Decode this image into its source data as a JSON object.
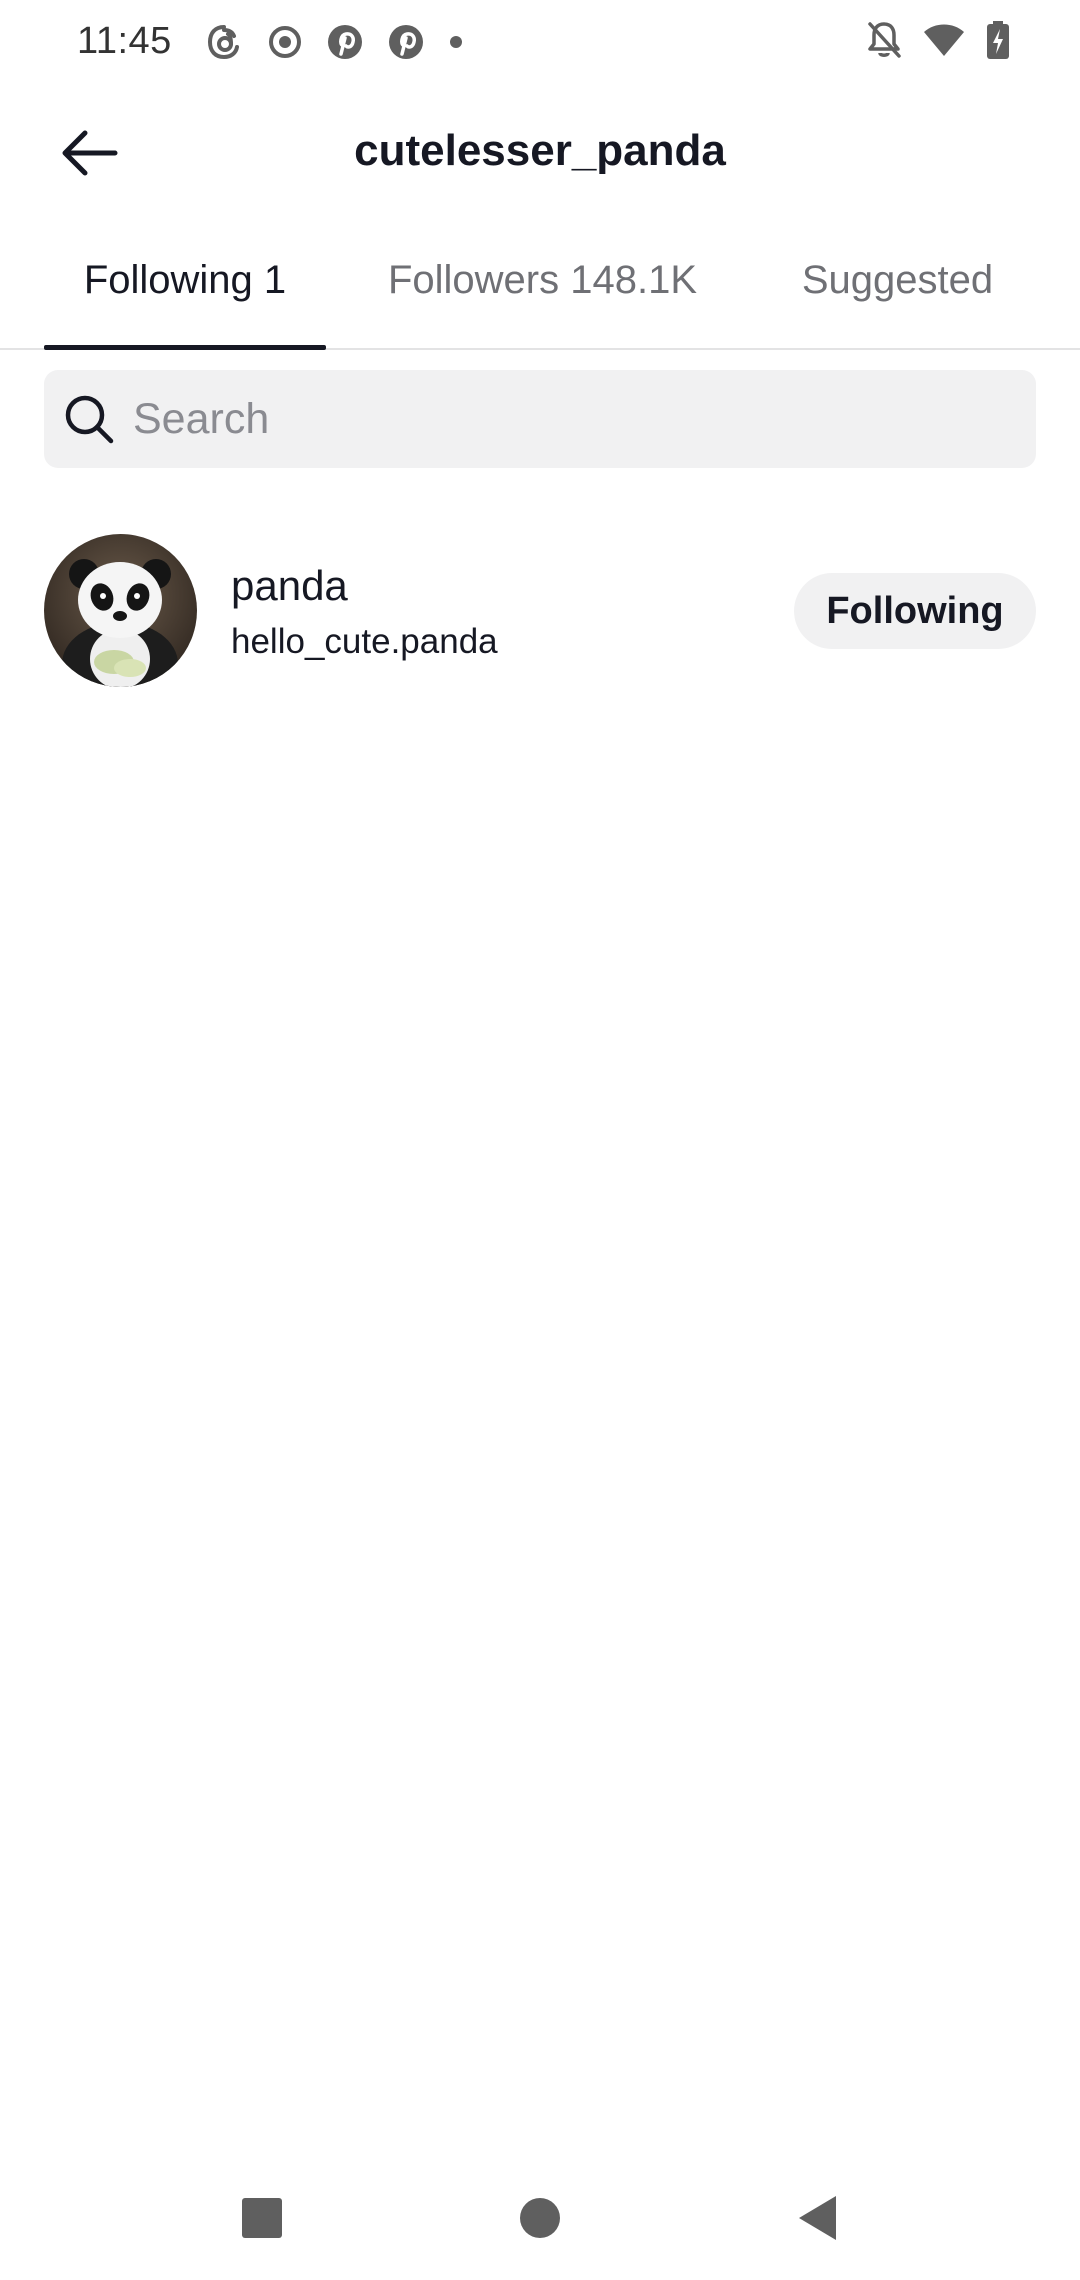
{
  "status_bar": {
    "time": "11:45",
    "left_icons": [
      "threads-icon",
      "record-icon",
      "pinterest-icon",
      "pinterest-icon",
      "dot-icon"
    ],
    "right_icons": [
      "notifications-muted-icon",
      "wifi-icon",
      "battery-charging-icon"
    ]
  },
  "header": {
    "title": "cutelesser_panda",
    "back_icon": "arrow-left-icon"
  },
  "tabs": [
    {
      "label": "Following 1",
      "active": true
    },
    {
      "label": "Followers 148.1K",
      "active": false
    },
    {
      "label": "Suggested",
      "active": false
    }
  ],
  "search": {
    "placeholder": "Search",
    "value": "",
    "icon": "search-icon"
  },
  "users": [
    {
      "name": "panda",
      "handle": "hello_cute.panda",
      "button_label": "Following",
      "avatar": "panda-avatar"
    }
  ],
  "nav_bar": {
    "icons": [
      "recents-square-icon",
      "home-circle-icon",
      "back-triangle-icon"
    ]
  },
  "colors": {
    "text_primary": "#161823",
    "text_secondary": "#6f7075",
    "placeholder": "#8a8b91",
    "surface_gray": "#f1f1f2",
    "divider": "#e3e3e4",
    "indicator": "#161823",
    "system_icons": "#5f5f5f"
  }
}
